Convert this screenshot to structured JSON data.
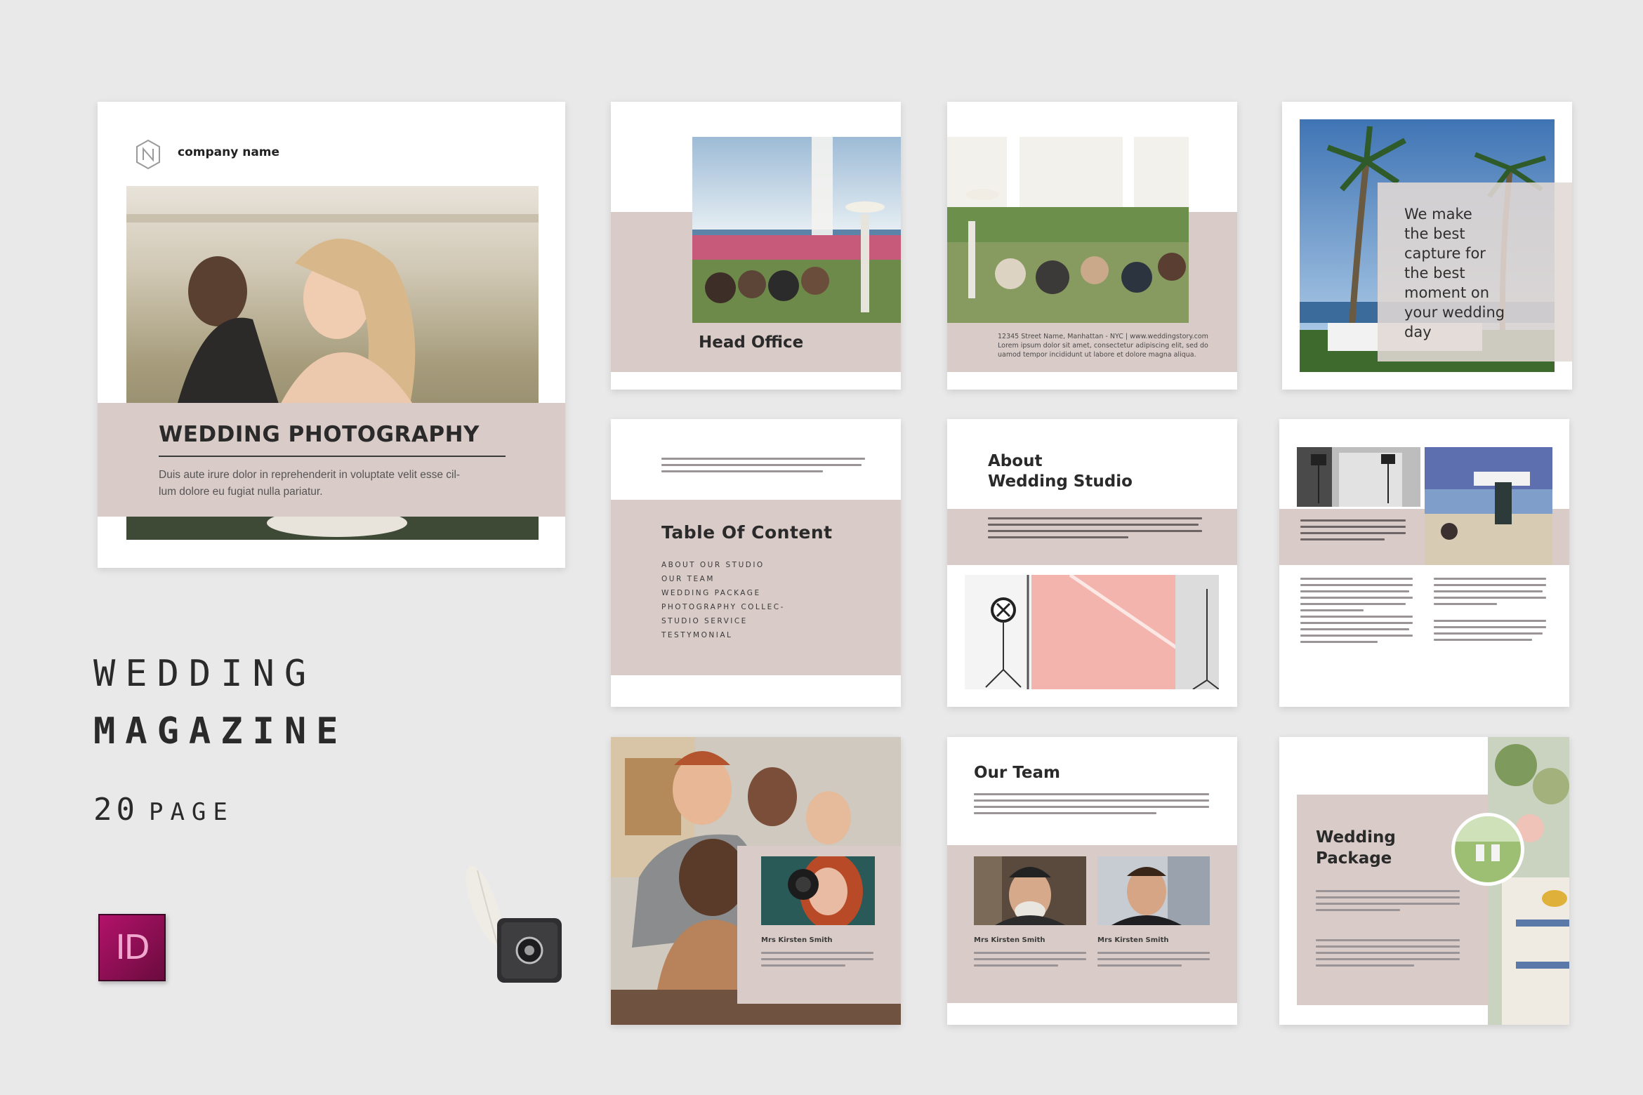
{
  "cover": {
    "company_name": "company name",
    "title": "WEDDING PHOTOGRAPHY",
    "description_line1": "Duis aute irure dolor in reprehenderit in voluptate velit esse cil-",
    "description_line2": "lum dolore eu fugiat nulla pariatur."
  },
  "caption": {
    "line1": "WEDDING",
    "line2": "MAGAZINE",
    "pages_number": "20",
    "pages_word": "PAGE"
  },
  "software_icon": {
    "label": "ID"
  },
  "pages": {
    "head_office": {
      "title": "Head Office"
    },
    "address": {
      "line1": "12345 Street Name, Manhattan - NYC | www.weddingstory.com",
      "line2": "Lorem ipsum dolor sit amet, consectetur adipiscing elit, sed do",
      "line3": "uamod tempor incididunt ut labore et dolore magna aliqua."
    },
    "quote": {
      "lines": [
        "We make",
        "the best",
        "capture for",
        "the best",
        "moment on",
        "your wedding",
        "day"
      ]
    },
    "toc": {
      "title": "Table Of Content",
      "items": [
        "ABOUT OUR STUDIO",
        "OUR TEAM",
        "WEDDING PACKAGE",
        "PHOTOGRAPHY COLLEC-",
        "STUDIO SERVICE",
        "TESTYMONIAL"
      ]
    },
    "about": {
      "title_line1": "About",
      "title_line2": "Wedding Studio"
    },
    "team_intro": {
      "caption": "Mrs Kirsten Smith"
    },
    "our_team": {
      "title": "Our Team",
      "caption_left": "Mrs Kirsten Smith",
      "caption_right": "Mrs Kirsten Smith"
    },
    "package": {
      "title_line1": "Wedding",
      "title_line2": "Package"
    }
  },
  "colors": {
    "background": "#e9e9ea",
    "accent_band": "#d9cbc7",
    "text_dark": "#2a2a2a",
    "indesign_magenta": "#b3126a"
  },
  "icons": [
    "logo-mark-icon",
    "indesign-icon",
    "camera-stamp-icon"
  ]
}
